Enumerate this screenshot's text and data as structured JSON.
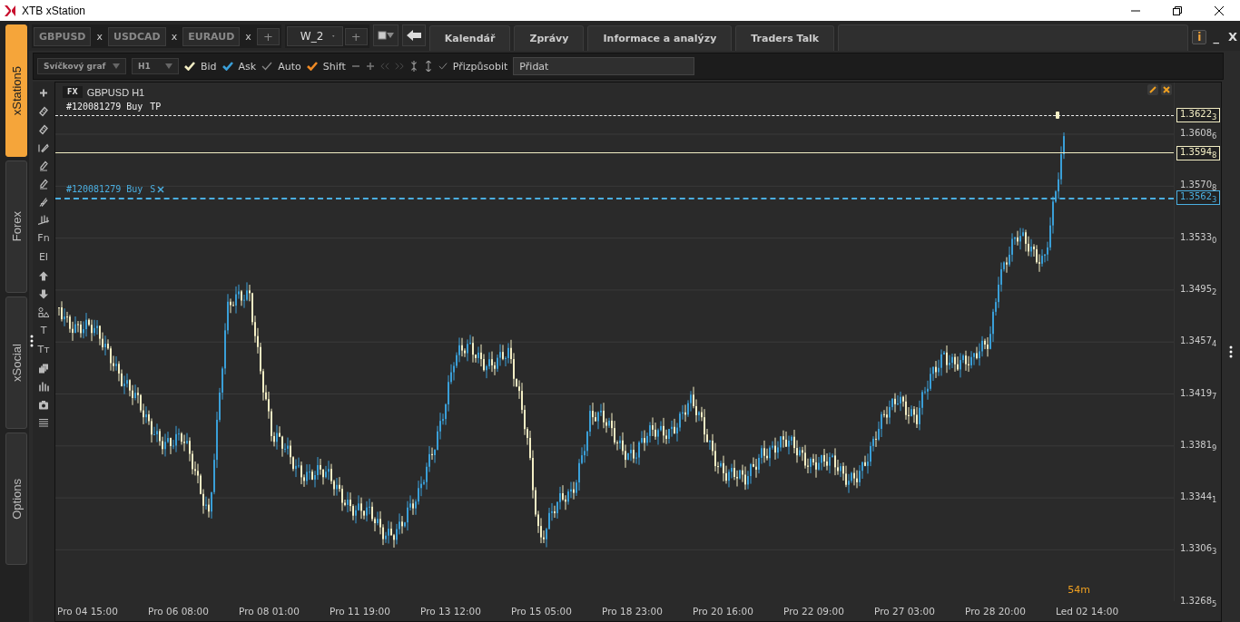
{
  "window": {
    "title": "XTB xStation"
  },
  "side_tabs": [
    {
      "label": "xStation5",
      "selected": true
    },
    {
      "label": "Forex",
      "selected": false
    },
    {
      "label": "xSocial",
      "selected": false
    },
    {
      "label": "Options",
      "selected": false
    }
  ],
  "instrument_tabs": [
    {
      "label": "GBPUSD",
      "close": "x"
    },
    {
      "label": "USDCAD",
      "close": "x"
    },
    {
      "label": "EURAUD",
      "close": "x"
    }
  ],
  "add_tab": "+",
  "workspace": {
    "name": "W_2",
    "add": "+"
  },
  "nav_tabs": [
    {
      "label": "Kalendář"
    },
    {
      "label": "Zprávy"
    },
    {
      "label": "Informace a analýzy"
    },
    {
      "label": "Traders Talk"
    }
  ],
  "panel_controls": {
    "info": "i",
    "minimize": "_",
    "close": "X"
  },
  "toolbar": {
    "chart_type": "Svíčkový graf",
    "interval": "H1",
    "toggles": [
      {
        "label": "Bid",
        "checked": true,
        "color": "#f3eec4"
      },
      {
        "label": "Ask",
        "checked": true,
        "color": "#3a9fd8"
      },
      {
        "label": "Auto",
        "checked": false,
        "color": "#888888"
      },
      {
        "label": "Shift",
        "checked": true,
        "color": "#f08a24"
      }
    ],
    "fit_label": "Přizpůsobit",
    "add_field": "Přidat"
  },
  "tools": [
    {
      "kind": "plus"
    },
    {
      "kind": "ruler"
    },
    {
      "kind": "ruler2"
    },
    {
      "kind": "line"
    },
    {
      "kind": "pencil"
    },
    {
      "kind": "pencil"
    },
    {
      "kind": "brush"
    },
    {
      "kind": "bars"
    },
    {
      "kind": "text",
      "label": "Fn"
    },
    {
      "kind": "text",
      "label": "EI"
    },
    {
      "kind": "up"
    },
    {
      "kind": "down"
    },
    {
      "kind": "shapes"
    },
    {
      "kind": "text",
      "label": "T"
    },
    {
      "kind": "text",
      "label": "Tᴛ"
    },
    {
      "kind": "layers"
    },
    {
      "kind": "volume"
    },
    {
      "kind": "camera"
    },
    {
      "kind": "list"
    }
  ],
  "chart": {
    "badge": "FX",
    "title": "GBPUSD H1",
    "orders": [
      {
        "label": "#120081279 Buy",
        "tag": "TP",
        "kind": "tp"
      },
      {
        "label": "#120081279 Buy",
        "tag": "S",
        "kind": "sl"
      }
    ],
    "price_tags": [
      {
        "text": "1.3622$_{3}$",
        "kind": "tp"
      },
      {
        "text": "1.3594$_{8}$",
        "kind": "bid"
      },
      {
        "text": "1.3562$_{3}$",
        "kind": "sl"
      }
    ],
    "price_ticks": [
      "1.3608$_{6}$",
      "1.3570$_{8}$",
      "1.3533$_{0}$",
      "1.3495$_{2}$",
      "1.3457$_{4}$",
      "1.3419$_{7}$",
      "1.3381$_{9}$",
      "1.3344$_{1}$",
      "1.3306$_{3}$",
      "1.3268$_{5}$"
    ],
    "time_labels": [
      "Pro 04 15:00",
      "Pro 06 08:00",
      "Pro 08 01:00",
      "Pro 11 19:00",
      "Pro 13 12:00",
      "Pro 15 05:00",
      "Pro 18 23:00",
      "Pro 20 16:00",
      "Pro 22 09:00",
      "Pro 27 03:00",
      "Pro 28 20:00",
      "Led 02 14:00"
    ],
    "countdown": "54m"
  }
}
